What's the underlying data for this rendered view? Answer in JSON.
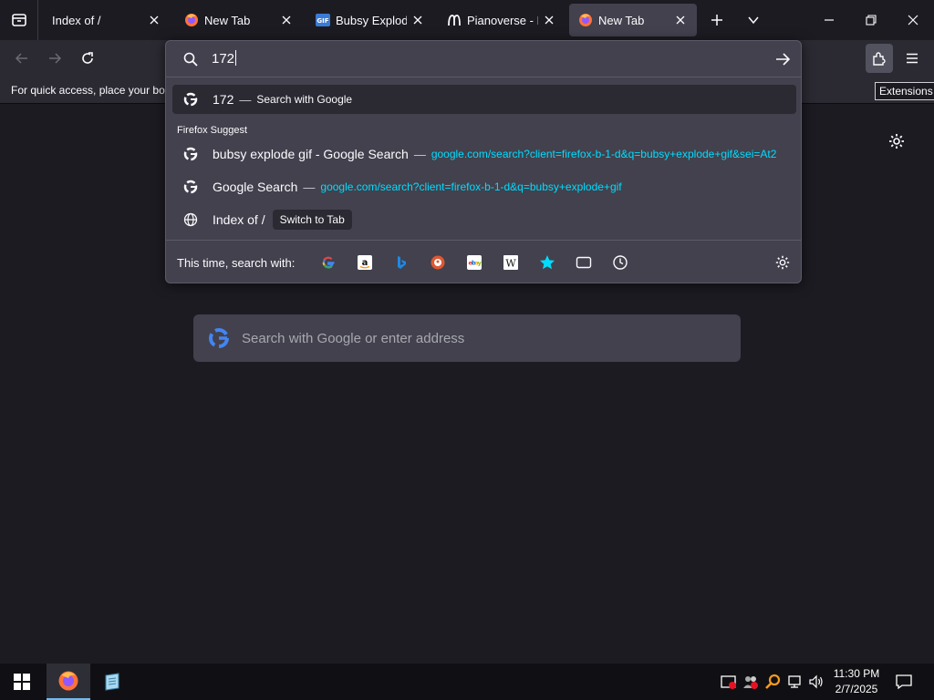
{
  "tabs": [
    {
      "title": "Index of /",
      "favicon": "none"
    },
    {
      "title": "New Tab",
      "favicon": "firefox"
    },
    {
      "title": "Bubsy Explode G",
      "favicon": "gif"
    },
    {
      "title": "Pianoverse - Lo",
      "favicon": "pianoverse"
    },
    {
      "title": "New Tab",
      "favicon": "firefox",
      "selected": true
    }
  ],
  "bookmarks_hint": "For quick access, place your boo",
  "urlbar": {
    "input_value": "172",
    "heuristic": {
      "text": "172",
      "sep": "—",
      "action": "Search with Google"
    },
    "suggest_label": "Firefox Suggest",
    "results": [
      {
        "title": "bubsy explode gif - Google Search",
        "sep": "—",
        "url": "google.com/search?client=firefox-b-1-d&q=bubsy+explode+gif&sei=At2",
        "icon": "google-icon"
      },
      {
        "title": "Google Search",
        "sep": "—",
        "url": "google.com/search?client=firefox-b-1-d&q=bubsy+explode+gif",
        "icon": "google-icon"
      },
      {
        "title": "Index of /",
        "action": "Switch to Tab",
        "icon": "globe-icon"
      }
    ],
    "oneoff_label": "This time, search with:"
  },
  "extensions_tooltip": "Extensions",
  "content": {
    "search_placeholder": "Search with Google or enter address"
  },
  "taskbar": {
    "time": "11:30 PM",
    "date": "2/7/2025"
  },
  "colors": {
    "accent": "#00ddff",
    "panel": "#42414d",
    "toolbar": "#2b2a33",
    "bg": "#1c1b22"
  }
}
